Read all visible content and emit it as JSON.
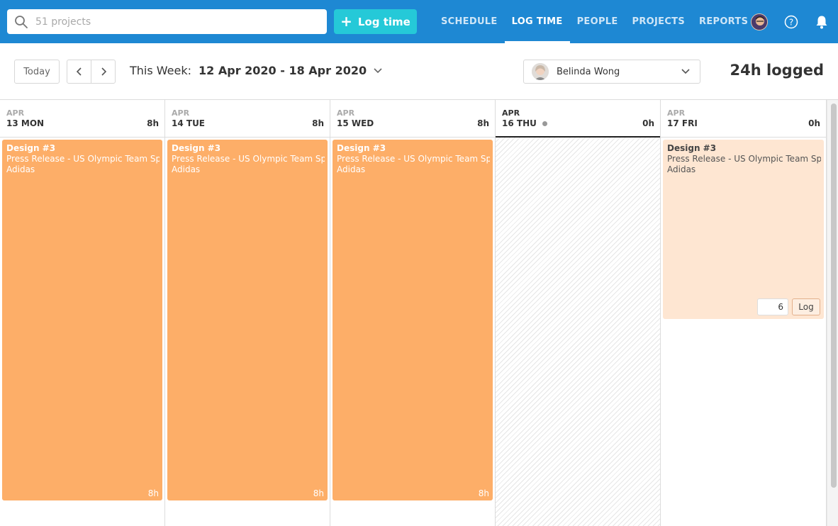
{
  "nav": {
    "search_placeholder": "51 projects",
    "log_time_button": "Log time",
    "links": [
      "SCHEDULE",
      "LOG TIME",
      "PEOPLE",
      "PROJECTS",
      "REPORTS"
    ],
    "active_link": "LOG TIME",
    "icons": [
      "search-icon",
      "plus-icon",
      "avatar",
      "help-icon",
      "bell-icon"
    ]
  },
  "toolbar": {
    "today_label": "Today",
    "week_prefix": "This Week:",
    "week_range": "12 Apr 2020 - 18 Apr 2020",
    "person_name": "Belinda Wong",
    "logged_total": "24h logged"
  },
  "days": [
    {
      "month": "APR",
      "day": "13 MON",
      "hours": "8h"
    },
    {
      "month": "APR",
      "day": "14 TUE",
      "hours": "8h"
    },
    {
      "month": "APR",
      "day": "15 WED",
      "hours": "8h"
    },
    {
      "month": "APR",
      "day": "16 THU",
      "hours": "0h",
      "is_today": true
    },
    {
      "month": "APR",
      "day": "17 FRI",
      "hours": "0h"
    }
  ],
  "entries": [
    {
      "title": "Design #3",
      "name": "Press Release - US Olympic Team Sponsorship",
      "client": "Adidas",
      "hours": "8h"
    },
    {
      "title": "Design #3",
      "name": "Press Release - US Olympic Team Sponsorship",
      "client": "Adidas",
      "hours": "8h"
    },
    {
      "title": "Design #3",
      "name": "Press Release - US Olympic Team Sponsorship",
      "client": "Adidas",
      "hours": "8h"
    },
    {
      "title": "Design #3",
      "name": "Press Release - US Olympic Team Sponsorship",
      "client": "Adidas",
      "log_value": "6",
      "log_button": "Log"
    }
  ],
  "colors": {
    "topbar": "#1e88d3",
    "log_button": "#25c9d8",
    "entry_logged": "#fdae68",
    "entry_pending": "#fee6d2"
  }
}
